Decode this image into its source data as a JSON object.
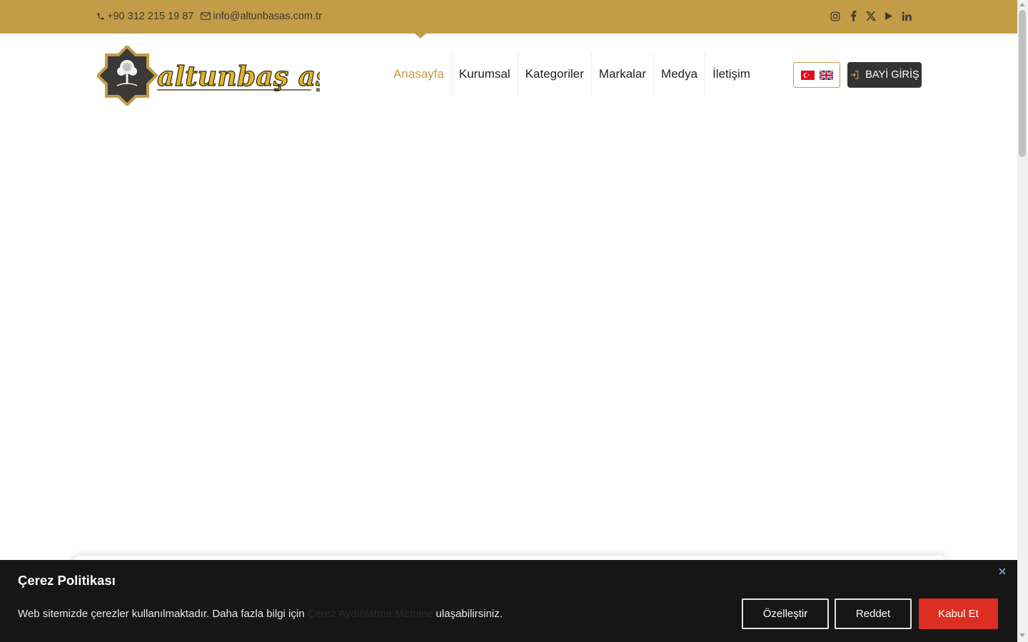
{
  "topbar": {
    "phone": "+90 312 215 19 87",
    "email": "info@altunbasas.com.tr",
    "social": [
      "instagram-icon",
      "facebook-icon",
      "x-icon",
      "youtube-icon",
      "linkedin-icon"
    ]
  },
  "logo": {
    "text": "altunbaş aş."
  },
  "nav": {
    "items": [
      "Anasayfa",
      "Kurumsal",
      "Kategoriler",
      "Markalar",
      "Medya",
      "İletişim"
    ],
    "active": "Anasayfa"
  },
  "languages": [
    "turkey-flag-icon",
    "uk-flag-icon"
  ],
  "dealer_login": {
    "label": "BAYİ GİRİŞ"
  },
  "cookie": {
    "title": "Çerez Politikası",
    "text_before": "Web sitemizde çerezler kullanılmaktadır. Daha fazla bilgi için ",
    "link": "Çerez Aydınlatma Metnine",
    "text_after": " ulaşabilirsiniz.",
    "customize_label": "Özelleştir",
    "reject_label": "Reddet",
    "accept_label": "Kabul Et"
  },
  "colors": {
    "brand_gold": "#c29c47",
    "dark": "#333333",
    "accept_red": "#dc2e22",
    "cookie_bg": "#161616"
  }
}
